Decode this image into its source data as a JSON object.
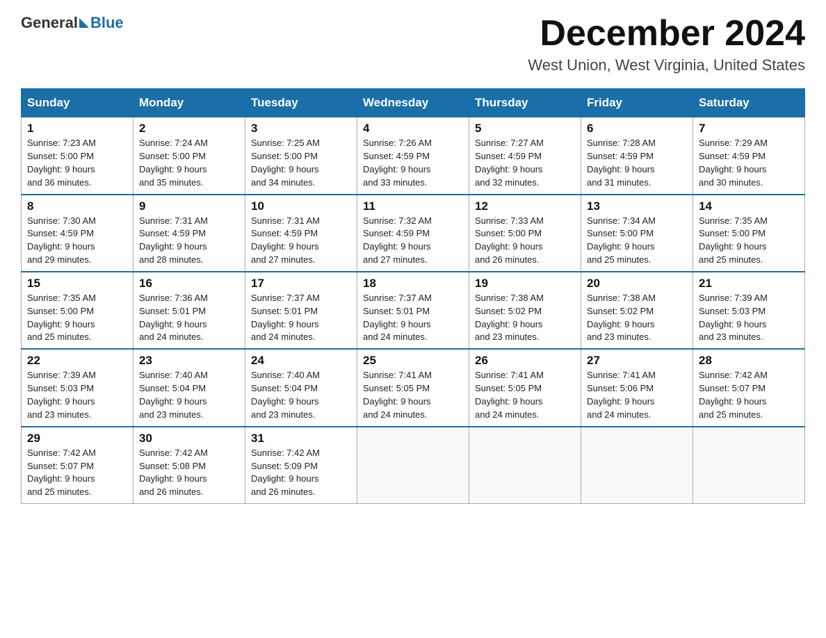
{
  "logo": {
    "general": "General",
    "blue": "Blue"
  },
  "title": "December 2024",
  "location": "West Union, West Virginia, United States",
  "weekdays": [
    "Sunday",
    "Monday",
    "Tuesday",
    "Wednesday",
    "Thursday",
    "Friday",
    "Saturday"
  ],
  "weeks": [
    [
      {
        "day": "1",
        "sunrise": "7:23 AM",
        "sunset": "5:00 PM",
        "daylight": "9 hours and 36 minutes."
      },
      {
        "day": "2",
        "sunrise": "7:24 AM",
        "sunset": "5:00 PM",
        "daylight": "9 hours and 35 minutes."
      },
      {
        "day": "3",
        "sunrise": "7:25 AM",
        "sunset": "5:00 PM",
        "daylight": "9 hours and 34 minutes."
      },
      {
        "day": "4",
        "sunrise": "7:26 AM",
        "sunset": "4:59 PM",
        "daylight": "9 hours and 33 minutes."
      },
      {
        "day": "5",
        "sunrise": "7:27 AM",
        "sunset": "4:59 PM",
        "daylight": "9 hours and 32 minutes."
      },
      {
        "day": "6",
        "sunrise": "7:28 AM",
        "sunset": "4:59 PM",
        "daylight": "9 hours and 31 minutes."
      },
      {
        "day": "7",
        "sunrise": "7:29 AM",
        "sunset": "4:59 PM",
        "daylight": "9 hours and 30 minutes."
      }
    ],
    [
      {
        "day": "8",
        "sunrise": "7:30 AM",
        "sunset": "4:59 PM",
        "daylight": "9 hours and 29 minutes."
      },
      {
        "day": "9",
        "sunrise": "7:31 AM",
        "sunset": "4:59 PM",
        "daylight": "9 hours and 28 minutes."
      },
      {
        "day": "10",
        "sunrise": "7:31 AM",
        "sunset": "4:59 PM",
        "daylight": "9 hours and 27 minutes."
      },
      {
        "day": "11",
        "sunrise": "7:32 AM",
        "sunset": "4:59 PM",
        "daylight": "9 hours and 27 minutes."
      },
      {
        "day": "12",
        "sunrise": "7:33 AM",
        "sunset": "5:00 PM",
        "daylight": "9 hours and 26 minutes."
      },
      {
        "day": "13",
        "sunrise": "7:34 AM",
        "sunset": "5:00 PM",
        "daylight": "9 hours and 25 minutes."
      },
      {
        "day": "14",
        "sunrise": "7:35 AM",
        "sunset": "5:00 PM",
        "daylight": "9 hours and 25 minutes."
      }
    ],
    [
      {
        "day": "15",
        "sunrise": "7:35 AM",
        "sunset": "5:00 PM",
        "daylight": "9 hours and 25 minutes."
      },
      {
        "day": "16",
        "sunrise": "7:36 AM",
        "sunset": "5:01 PM",
        "daylight": "9 hours and 24 minutes."
      },
      {
        "day": "17",
        "sunrise": "7:37 AM",
        "sunset": "5:01 PM",
        "daylight": "9 hours and 24 minutes."
      },
      {
        "day": "18",
        "sunrise": "7:37 AM",
        "sunset": "5:01 PM",
        "daylight": "9 hours and 24 minutes."
      },
      {
        "day": "19",
        "sunrise": "7:38 AM",
        "sunset": "5:02 PM",
        "daylight": "9 hours and 23 minutes."
      },
      {
        "day": "20",
        "sunrise": "7:38 AM",
        "sunset": "5:02 PM",
        "daylight": "9 hours and 23 minutes."
      },
      {
        "day": "21",
        "sunrise": "7:39 AM",
        "sunset": "5:03 PM",
        "daylight": "9 hours and 23 minutes."
      }
    ],
    [
      {
        "day": "22",
        "sunrise": "7:39 AM",
        "sunset": "5:03 PM",
        "daylight": "9 hours and 23 minutes."
      },
      {
        "day": "23",
        "sunrise": "7:40 AM",
        "sunset": "5:04 PM",
        "daylight": "9 hours and 23 minutes."
      },
      {
        "day": "24",
        "sunrise": "7:40 AM",
        "sunset": "5:04 PM",
        "daylight": "9 hours and 23 minutes."
      },
      {
        "day": "25",
        "sunrise": "7:41 AM",
        "sunset": "5:05 PM",
        "daylight": "9 hours and 24 minutes."
      },
      {
        "day": "26",
        "sunrise": "7:41 AM",
        "sunset": "5:05 PM",
        "daylight": "9 hours and 24 minutes."
      },
      {
        "day": "27",
        "sunrise": "7:41 AM",
        "sunset": "5:06 PM",
        "daylight": "9 hours and 24 minutes."
      },
      {
        "day": "28",
        "sunrise": "7:42 AM",
        "sunset": "5:07 PM",
        "daylight": "9 hours and 25 minutes."
      }
    ],
    [
      {
        "day": "29",
        "sunrise": "7:42 AM",
        "sunset": "5:07 PM",
        "daylight": "9 hours and 25 minutes."
      },
      {
        "day": "30",
        "sunrise": "7:42 AM",
        "sunset": "5:08 PM",
        "daylight": "9 hours and 26 minutes."
      },
      {
        "day": "31",
        "sunrise": "7:42 AM",
        "sunset": "5:09 PM",
        "daylight": "9 hours and 26 minutes."
      },
      null,
      null,
      null,
      null
    ]
  ],
  "labels": {
    "sunrise": "Sunrise:",
    "sunset": "Sunset:",
    "daylight": "Daylight:"
  }
}
